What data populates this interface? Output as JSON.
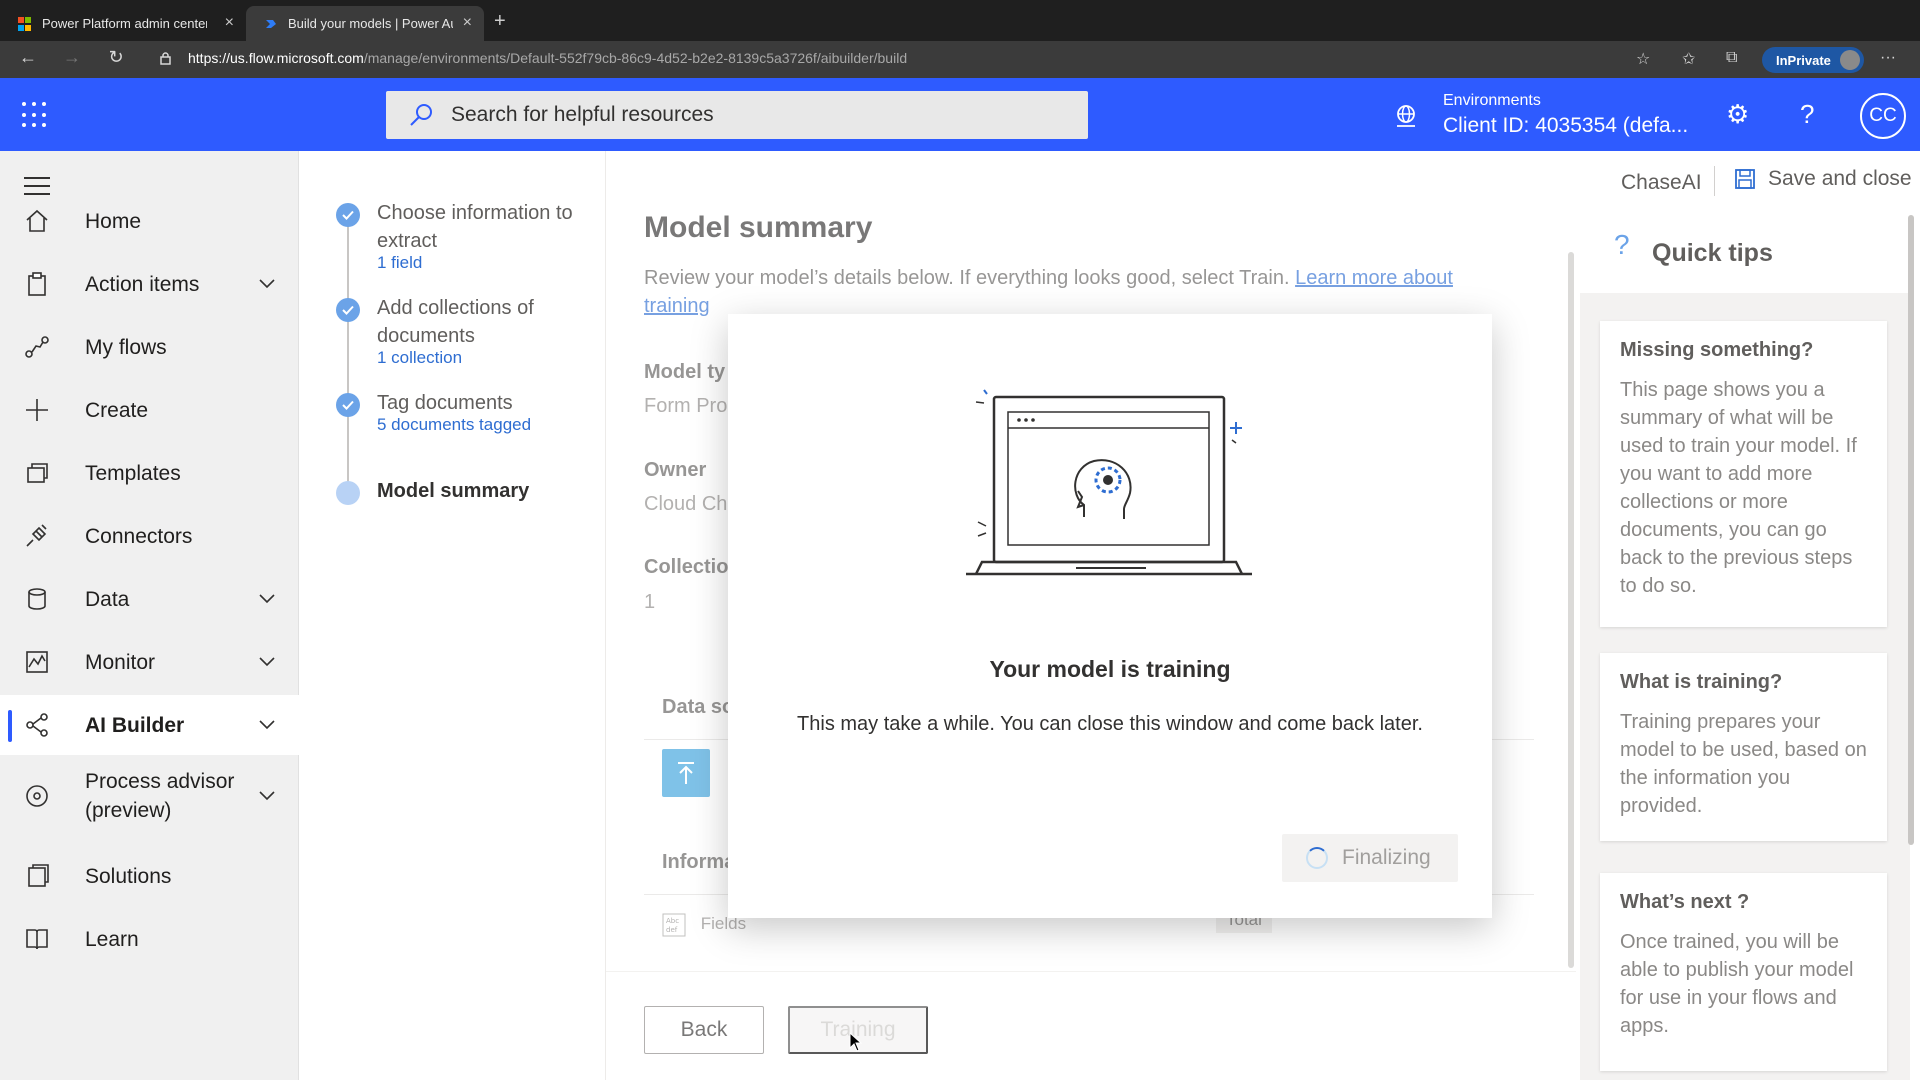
{
  "browser": {
    "tabs": [
      {
        "title": "Power Platform admin center",
        "favicon": "microsoft-logo",
        "active": false
      },
      {
        "title": "Build your models | Power Aut",
        "favicon": "power-automate-icon",
        "active": true
      }
    ],
    "url_host": "https://us.flow.microsoft.com",
    "url_path": "/manage/environments/Default-552f79cb-86c9-4d52-b2e2-8139c5a3726f/aibuilder/build",
    "inprivate_label": "InPrivate"
  },
  "header": {
    "search_placeholder": "Search for helpful resources",
    "env_label": "Environments",
    "env_value": "Client ID: 4035354 (defa...",
    "avatar_initials": "CC",
    "brand_color": "#2e5bff"
  },
  "leftnav": {
    "items": [
      {
        "label": "Home",
        "icon": "home-icon",
        "chevron": false
      },
      {
        "label": "Action items",
        "icon": "clipboard-icon",
        "chevron": true
      },
      {
        "label": "My flows",
        "icon": "flow-icon",
        "chevron": false
      },
      {
        "label": "Create",
        "icon": "plus-icon",
        "chevron": false
      },
      {
        "label": "Templates",
        "icon": "templates-icon",
        "chevron": false
      },
      {
        "label": "Connectors",
        "icon": "plug-icon",
        "chevron": false
      },
      {
        "label": "Data",
        "icon": "cylinder-icon",
        "chevron": true
      },
      {
        "label": "Monitor",
        "icon": "monitor-icon",
        "chevron": true
      },
      {
        "label": "AI Builder",
        "icon": "ai-builder-icon",
        "chevron": true,
        "active": true
      },
      {
        "label": "Process advisor (preview)",
        "icon": "process-advisor-icon",
        "chevron": true
      },
      {
        "label": "Solutions",
        "icon": "solutions-icon",
        "chevron": false
      },
      {
        "label": "Learn",
        "icon": "book-icon",
        "chevron": false
      }
    ]
  },
  "stepper": {
    "steps": [
      {
        "title": "Choose information to extract",
        "sub": "1 field",
        "status": "done"
      },
      {
        "title": "Add collections of documents",
        "sub": "1 collection",
        "status": "done"
      },
      {
        "title": "Tag documents",
        "sub": "5 documents tagged",
        "status": "done"
      },
      {
        "title": "Model summary",
        "sub": "",
        "status": "current"
      }
    ]
  },
  "cmdbar": {
    "model_name": "ChaseAI",
    "save_label": "Save and close"
  },
  "main": {
    "title": "Model summary",
    "desc": "Review your model’s details below. If everything looks good, select Train. ",
    "link": "Learn more about training",
    "model_type_label": "Model ty",
    "model_type_value": "Form Pro",
    "owner_label": "Owner",
    "owner_value": "Cloud Ch",
    "collections_label": "Collectio",
    "collections_value": "1",
    "data_source_label": "Data so",
    "information_label": "Informa",
    "fields_label": "Fields",
    "total_label": "Total"
  },
  "footer": {
    "back_label": "Back",
    "train_label": "Training"
  },
  "tips": {
    "title": "Quick tips",
    "cards": [
      {
        "title": "Missing something?",
        "body": "This page shows you a summary of what will be used to train your model. If you want to add more collections or more documents, you can go back to the previous steps to do so."
      },
      {
        "title": "What is training?",
        "body": "Training prepares your model to be used, based on the information you provided."
      },
      {
        "title": "What’s next ?",
        "body": "Once trained, you will be able to publish your model for use in your flows and apps."
      }
    ]
  },
  "modal": {
    "title": "Your model is training",
    "desc": "This may take a while. You can close this window and come back later.",
    "button_label": "Finalizing"
  }
}
